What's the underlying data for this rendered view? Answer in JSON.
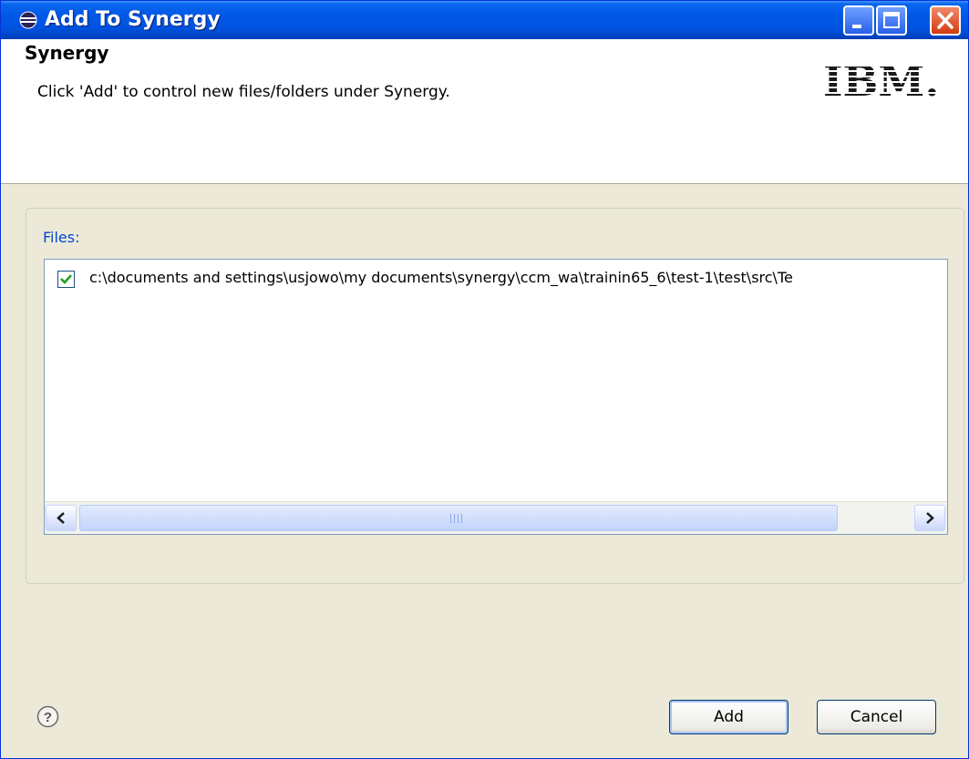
{
  "window": {
    "title": "Add To Synergy",
    "app_icon": "eclipse-icon",
    "controls": [
      "minimize-icon",
      "maximize-icon",
      "close-icon"
    ]
  },
  "banner": {
    "title": "Synergy",
    "description": "Click 'Add' to control new files/folders under Synergy.",
    "logo": "IBM."
  },
  "files": {
    "label": "Files:",
    "items": [
      {
        "checked": true,
        "path": "c:\\documents and settings\\usjowo\\my documents\\synergy\\ccm_wa\\trainin65_6\\test-1\\test\\src\\Te"
      }
    ]
  },
  "footer": {
    "help_icon": "help-icon",
    "add_label": "Add",
    "cancel_label": "Cancel"
  },
  "colors": {
    "titlebar": "#0058e6",
    "files_label": "#0046d5",
    "checkmark": "#21a121",
    "dialog_bg": "#ece9d8"
  }
}
